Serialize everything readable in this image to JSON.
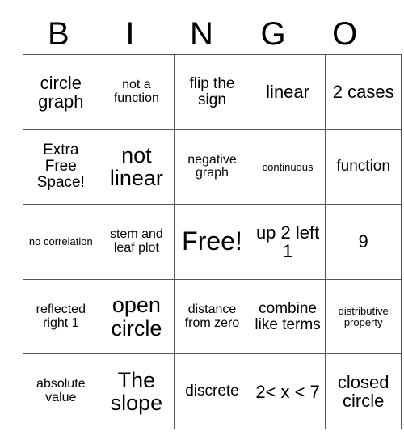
{
  "header": {
    "letters": [
      "B",
      "I",
      "N",
      "G",
      "O"
    ]
  },
  "grid": {
    "columns": 5,
    "rows": 5,
    "cells": [
      [
        {
          "text": "circle graph",
          "size": "fs-l"
        },
        {
          "text": "not a function",
          "size": "fs-s"
        },
        {
          "text": "flip the sign",
          "size": "fs-m"
        },
        {
          "text": "linear",
          "size": "fs-l"
        },
        {
          "text": "2 cases",
          "size": "fs-l"
        }
      ],
      [
        {
          "text": "Extra Free Space!",
          "size": "fs-m"
        },
        {
          "text": "not linear",
          "size": "fs-xl"
        },
        {
          "text": "negative graph",
          "size": "fs-s"
        },
        {
          "text": "continuous",
          "size": "fs-xs"
        },
        {
          "text": "function",
          "size": "fs-m"
        }
      ],
      [
        {
          "text": "no correlation",
          "size": "fs-xs"
        },
        {
          "text": "stem and leaf plot",
          "size": "fs-s"
        },
        {
          "text": "Free!",
          "size": "fs-xxl"
        },
        {
          "text": "up 2 left 1",
          "size": "fs-l"
        },
        {
          "text": "9",
          "size": "fs-l"
        }
      ],
      [
        {
          "text": "reflected right 1",
          "size": "fs-s"
        },
        {
          "text": "open circle",
          "size": "fs-xl"
        },
        {
          "text": "distance from zero",
          "size": "fs-s"
        },
        {
          "text": "combine like terms",
          "size": "fs-m"
        },
        {
          "text": "distributive property",
          "size": "fs-xs"
        }
      ],
      [
        {
          "text": "absolute value",
          "size": "fs-s"
        },
        {
          "text": "The slope",
          "size": "fs-xl"
        },
        {
          "text": "discrete",
          "size": "fs-m"
        },
        {
          "text": "2< x < 7",
          "size": "fs-l"
        },
        {
          "text": "closed circle",
          "size": "fs-l"
        }
      ]
    ]
  },
  "colors": {
    "background": "#ffffff",
    "text": "#000000",
    "grid_line": "#555555"
  }
}
